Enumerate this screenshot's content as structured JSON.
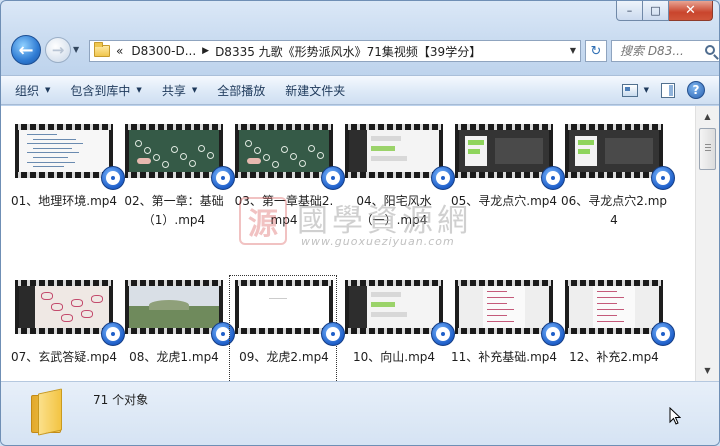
{
  "window": {
    "caption_min": "–",
    "caption_max": "□",
    "caption_close": "✕"
  },
  "nav": {
    "back_glyph": "←",
    "forward_glyph": "→",
    "history_glyph": "▼",
    "breadcrumb_prefix": "«",
    "breadcrumbs": [
      "D8300-D...",
      "D8335 九歌《形势派风水》71集视频【39学分】"
    ],
    "address_dropdown": "▼",
    "refresh_glyph": "↻",
    "search_placeholder": "搜索 D83..."
  },
  "toolbar": {
    "items": [
      {
        "label": "组织",
        "arrow": "▼"
      },
      {
        "label": "包含到库中",
        "arrow": "▼"
      },
      {
        "label": "共享",
        "arrow": "▼"
      },
      {
        "label": "全部播放",
        "arrow": ""
      },
      {
        "label": "新建文件夹",
        "arrow": ""
      }
    ],
    "view_arrow": "▼",
    "help_glyph": "?"
  },
  "files": [
    {
      "name": "01、地理环境.mp4",
      "theme": "doc"
    },
    {
      "name": "02、第一章：基础（1）.mp4",
      "theme": "board"
    },
    {
      "name": "03、第一章基础2.mp4",
      "theme": "board"
    },
    {
      "name": "04、阳宅风水（一）.mp4",
      "theme": "chat"
    },
    {
      "name": "05、寻龙点穴.mp4",
      "theme": "phone"
    },
    {
      "name": "06、寻龙点穴2.mp4",
      "theme": "phone"
    },
    {
      "name": "07、玄武答疑.mp4",
      "theme": "map"
    },
    {
      "name": "08、龙虎1.mp4",
      "theme": "photo"
    },
    {
      "name": "09、龙虎2.mp4",
      "theme": "white"
    },
    {
      "name": "10、向山.mp4",
      "theme": "chat"
    },
    {
      "name": "11、补充基础.mp4",
      "theme": "paper"
    },
    {
      "name": "12、补充2.mp4",
      "theme": "paper"
    }
  ],
  "selected_index": 8,
  "status": {
    "count_text": "71 个对象"
  },
  "watermark": {
    "seal": "源",
    "title": "國學資源網",
    "url": "www.guoxueziyuan.com"
  },
  "colors": {
    "accent": "#2f7bd3",
    "media_badge": "#1f5fc9",
    "close_button": "#c9452d"
  }
}
